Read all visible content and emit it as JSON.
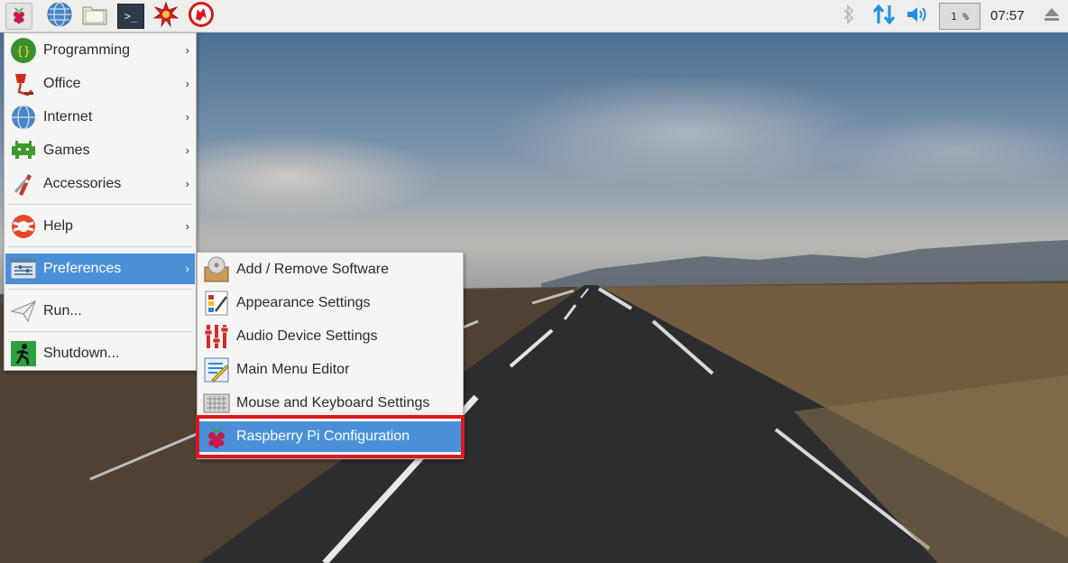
{
  "panel": {
    "launchers": [
      {
        "icon": "raspberry-menu-icon"
      },
      {
        "icon": "web-browser-icon"
      },
      {
        "icon": "file-manager-icon"
      },
      {
        "icon": "terminal-icon"
      },
      {
        "icon": "mathematica-icon"
      },
      {
        "icon": "wolfram-icon"
      }
    ],
    "terminal_glyph": ">_",
    "cpu_usage": "1 %",
    "clock": "07:57",
    "tray_icons": [
      "bluetooth-icon",
      "network-icon",
      "volume-icon",
      "eject-icon"
    ]
  },
  "main_menu": {
    "items": [
      {
        "label": "Programming",
        "icon": "programming-icon",
        "has_submenu": true
      },
      {
        "label": "Office",
        "icon": "office-icon",
        "has_submenu": true
      },
      {
        "label": "Internet",
        "icon": "internet-icon",
        "has_submenu": true
      },
      {
        "label": "Games",
        "icon": "games-icon",
        "has_submenu": true
      },
      {
        "label": "Accessories",
        "icon": "accessories-icon",
        "has_submenu": true
      },
      {
        "label": "Help",
        "icon": "help-icon",
        "has_submenu": true
      },
      {
        "label": "Preferences",
        "icon": "preferences-icon",
        "has_submenu": true,
        "active": true
      },
      {
        "label": "Run...",
        "icon": "run-icon",
        "has_submenu": false
      },
      {
        "label": "Shutdown...",
        "icon": "shutdown-icon",
        "has_submenu": false
      }
    ],
    "arrow_glyph": "›"
  },
  "preferences_submenu": {
    "items": [
      {
        "label": "Add / Remove Software",
        "icon": "add-remove-software-icon"
      },
      {
        "label": "Appearance Settings",
        "icon": "appearance-settings-icon"
      },
      {
        "label": "Audio Device Settings",
        "icon": "audio-device-settings-icon"
      },
      {
        "label": "Main Menu Editor",
        "icon": "main-menu-editor-icon"
      },
      {
        "label": "Mouse and Keyboard Settings",
        "icon": "mouse-keyboard-settings-icon"
      },
      {
        "label": "Raspberry Pi Configuration",
        "icon": "raspberry-pi-configuration-icon",
        "active": true
      }
    ]
  },
  "colors": {
    "selection": "#4a90d9",
    "highlight_border": "#e0161e",
    "panel_bg": "#eeeeec",
    "menu_bg": "#f5f5f4",
    "accent_blue": "#1e8fe0"
  }
}
